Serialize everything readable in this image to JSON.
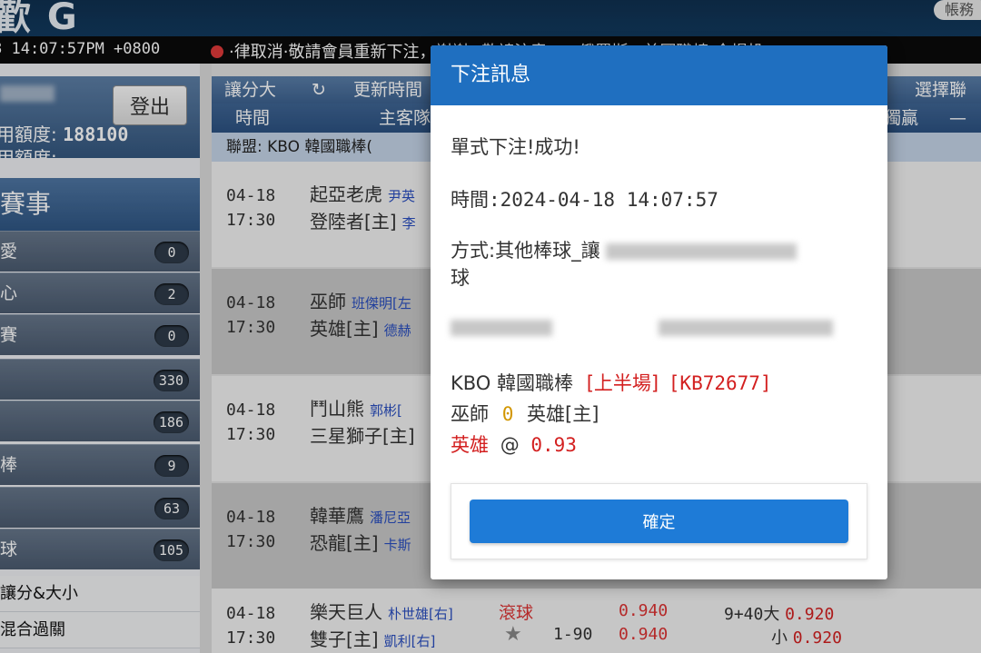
{
  "header": {
    "logo": "歡 G",
    "account_button": "帳務"
  },
  "ticker": {
    "clock": "8 14:07:57PM +0800",
    "marquee": "·律取消·敬請會員重新下注，謝謝。·敬請注意：...俄羅斯...美國職棒-全場投"
  },
  "sidebar": {
    "logout": "登出",
    "credit_label": "用額度:",
    "credit_value": "188100",
    "credit_label2": "用額度:",
    "events_title": "賽事",
    "sports": [
      {
        "label": "愛",
        "count": "0"
      },
      {
        "label": "心",
        "count": "2"
      },
      {
        "label": "賽",
        "count": "0"
      },
      {
        "label": "",
        "count": "330"
      },
      {
        "label": "",
        "count": "186"
      },
      {
        "label": "棒",
        "count": "9"
      },
      {
        "label": "",
        "count": "63"
      },
      {
        "label": "球",
        "count": "105"
      }
    ],
    "links": [
      "讓分&大小",
      "混合過關"
    ]
  },
  "main": {
    "toolbar": {
      "left": "讓分大",
      "refresh": "更新時間",
      "right": "選擇聯盟"
    },
    "columns": {
      "time": "時間",
      "home": "主客隊",
      "winner": "獨贏",
      "dash": "—"
    },
    "league": "聯盟: KBO 韓國職棒(",
    "matches": [
      {
        "date": "04-18",
        "time": "17:30",
        "team1": "起亞老虎",
        "pitcher1": "尹英",
        "team2": "登陸者[主]",
        "pitcher2": "李"
      },
      {
        "date": "04-18",
        "time": "17:30",
        "team1": "巫師",
        "pitcher1": "班傑明[左",
        "team2": "英雄[主]",
        "pitcher2": "德赫"
      },
      {
        "date": "04-18",
        "time": "17:30",
        "team1": "鬥山熊",
        "pitcher1": "郭彬[",
        "team2": "三星獅子[主]",
        "pitcher2": ""
      },
      {
        "date": "04-18",
        "time": "17:30",
        "team1": "韓華鷹",
        "pitcher1": "潘尼亞",
        "team2": "恐龍[主]",
        "pitcher2": "卡斯"
      },
      {
        "date": "04-18",
        "time": "17:30",
        "team1": "樂天巨人",
        "pitcher1": "朴世雄[右]",
        "team2": "雙子[主]",
        "pitcher2": "凱利[右]",
        "live": "滾球",
        "handicap": "1-90",
        "odds1": "0.940",
        "odds2": "0.940",
        "ou_line": "9+40",
        "ou_over": "大",
        "ou_over_odds": "0.920",
        "ou_under": "小",
        "ou_under_odds": "0.920"
      }
    ]
  },
  "modal": {
    "title": "下注訊息",
    "status": "單式下注!成功!",
    "time": "時間:2024-04-18 14:07:57",
    "method_prefix": "方式:其他棒球_讓",
    "method_suffix": "球",
    "league": "KBO 韓國職棒",
    "period": "[上半場]",
    "code": "[KB72677]",
    "team_away": "巫師",
    "score": "0",
    "team_home": "英雄[主]",
    "pick": "英雄",
    "at": "@",
    "price": "0.93",
    "confirm": "確定"
  },
  "colors": {
    "brand_blue": "#1f6fc0",
    "button_blue": "#1e7bd7",
    "red": "#d32020",
    "gold": "#d29600"
  }
}
